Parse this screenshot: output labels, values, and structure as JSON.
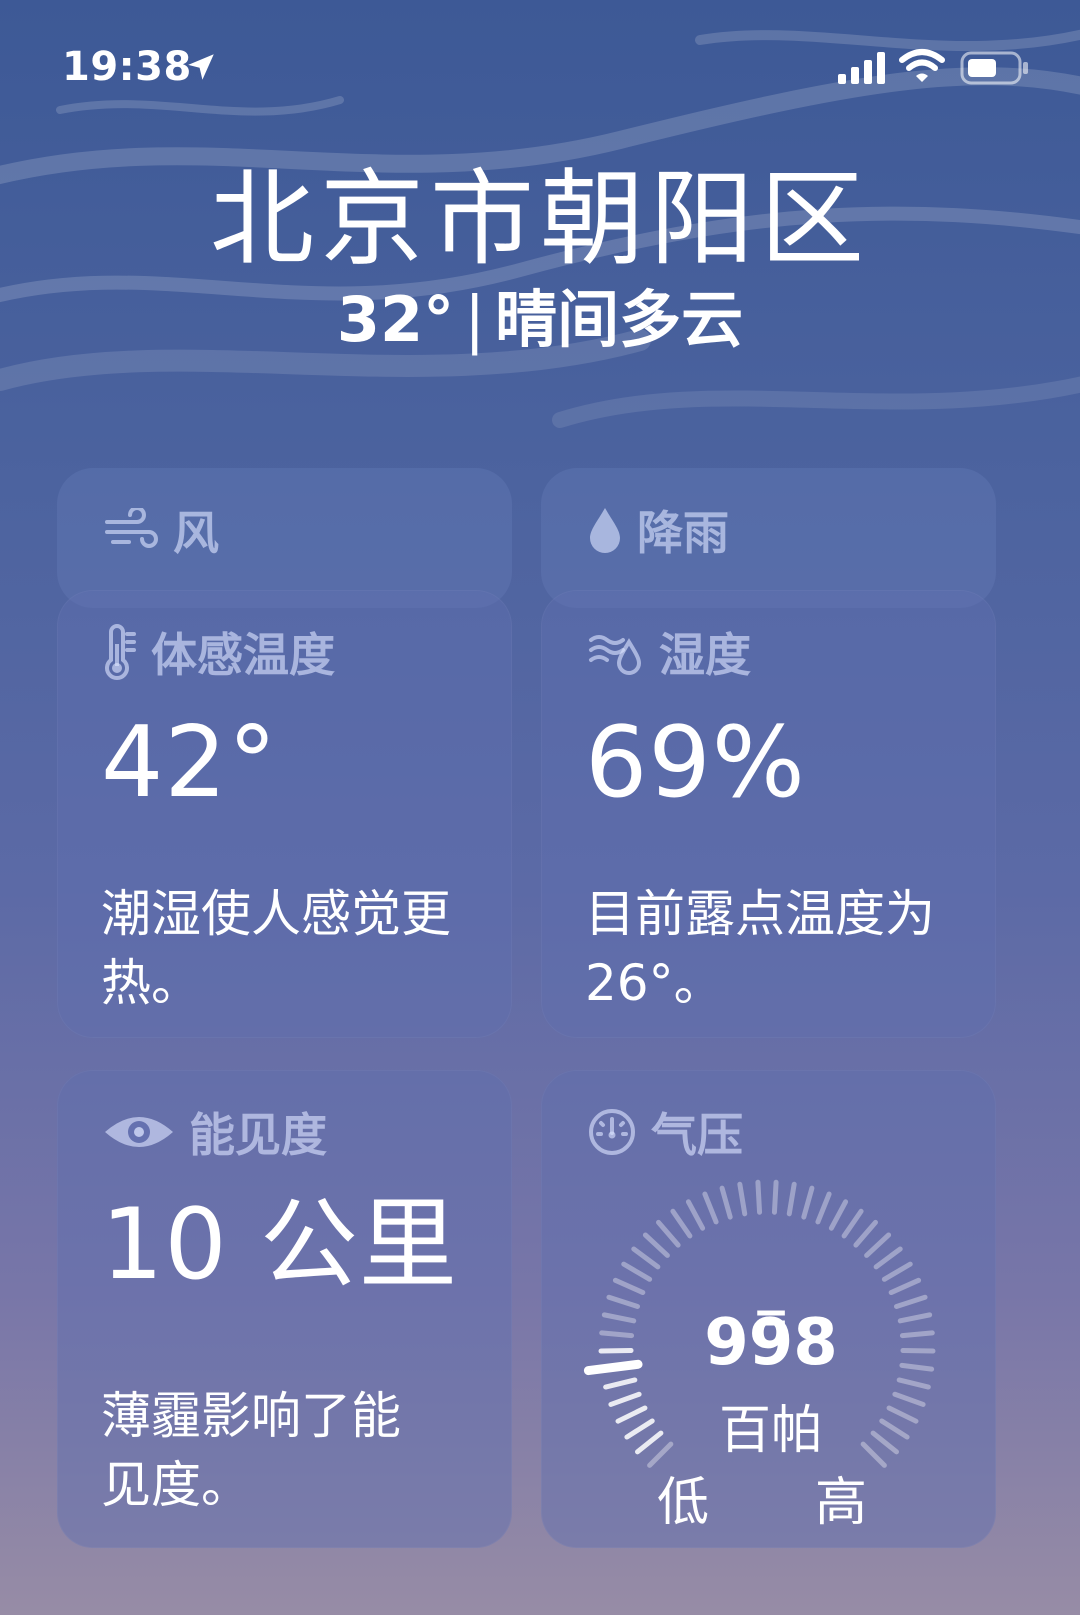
{
  "status_bar": {
    "time": "19:38",
    "icons": [
      "location-arrow-icon",
      "cellular-signal-icon",
      "wifi-icon",
      "battery-icon"
    ]
  },
  "header": {
    "location": "北京市朝阳区",
    "temperature": "32°",
    "separator": "|",
    "condition": "晴间多云"
  },
  "collapsed_cards": {
    "wind": {
      "label": "风",
      "icon": "wind-icon"
    },
    "precipitation": {
      "label": "降雨",
      "icon": "raindrop-icon"
    }
  },
  "cards": {
    "feels_like": {
      "label": "体感温度",
      "icon": "thermometer-icon",
      "value": "42°",
      "description": "潮湿使人感觉更热。"
    },
    "humidity": {
      "label": "湿度",
      "icon": "humidity-icon",
      "value": "69%",
      "description": "目前露点温度为 26°。"
    },
    "visibility": {
      "label": "能见度",
      "icon": "eye-icon",
      "value": "10 公里",
      "description": "薄霾影响了能见度。"
    },
    "pressure": {
      "label": "气压",
      "icon": "gauge-icon",
      "trend_symbol": "=",
      "value": "998",
      "unit": "百帕",
      "low_label": "低",
      "high_label": "高",
      "gauge_level": 0.14
    }
  },
  "colors": {
    "card_header": "#dce4ff",
    "background_top": "#3d5996",
    "background_bottom": "#978ca6"
  }
}
